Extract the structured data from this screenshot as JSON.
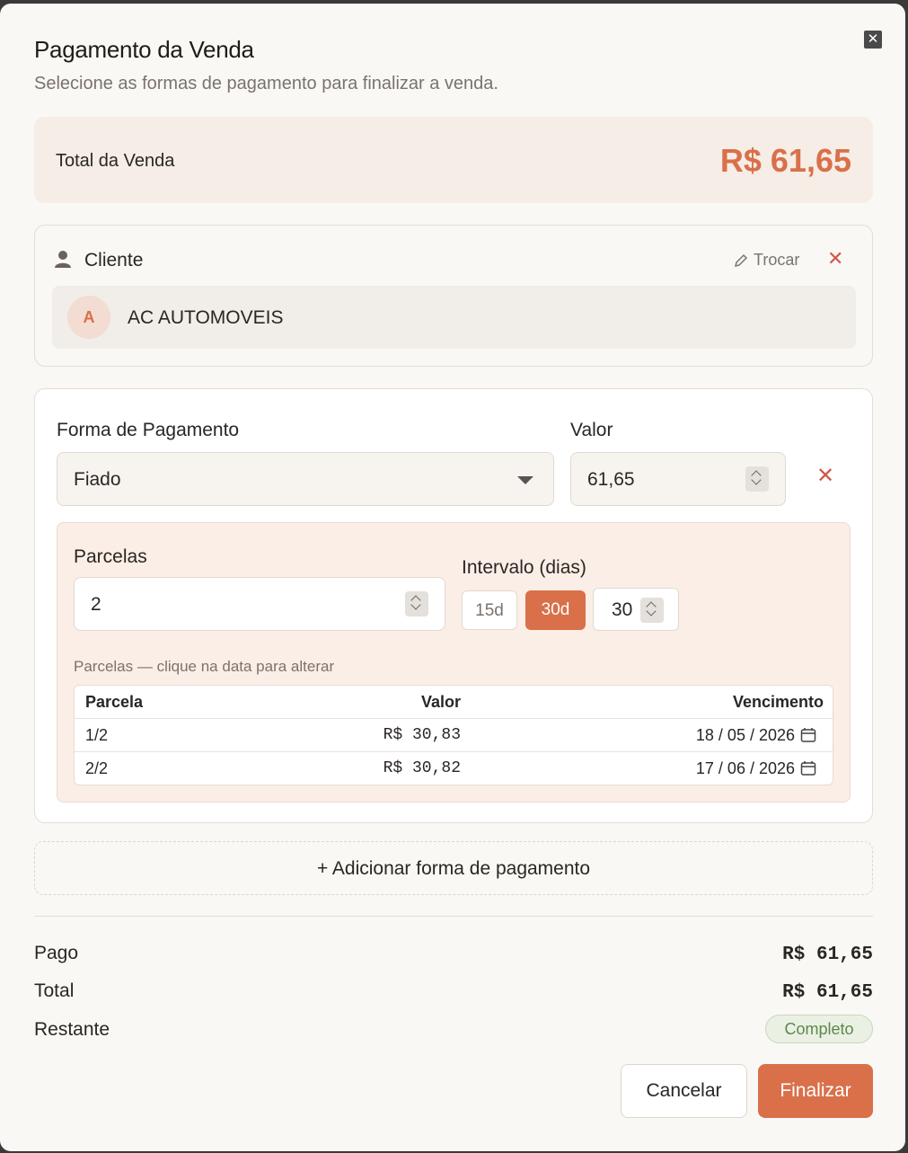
{
  "dialog": {
    "title": "Pagamento da Venda",
    "subtitle": "Selecione as formas de pagamento para finalizar a venda.",
    "close_icon": "close-icon"
  },
  "total": {
    "label": "Total da Venda",
    "value": "R$ 61,65",
    "accent_color": "#d9704a"
  },
  "client": {
    "label": "Cliente",
    "change_label": "Trocar",
    "avatar_letter": "A",
    "name": "AC AUTOMOVEIS"
  },
  "payment": {
    "method_label": "Forma de Pagamento",
    "method_value": "Fiado",
    "amount_label": "Valor",
    "amount_value": "61,65",
    "installments_label": "Parcelas",
    "installments_value": "2",
    "interval_label": "Intervalo (dias)",
    "interval_options": [
      "15d",
      "30d"
    ],
    "interval_selected": "30d",
    "interval_value": "30",
    "hint": "Parcelas — clique na data para alterar",
    "table": {
      "headers": [
        "Parcela",
        "Valor",
        "Vencimento"
      ],
      "rows": [
        {
          "parcela": "1/2",
          "valor": "R$ 30,83",
          "vencimento": "18 / 05 / 2026"
        },
        {
          "parcela": "2/2",
          "valor": "R$ 30,82",
          "vencimento": "17 / 06 / 2026"
        }
      ]
    }
  },
  "add_payment_label": "+ Adicionar forma de pagamento",
  "summary": {
    "paid_label": "Pago",
    "paid_value": "R$ 61,65",
    "total_label": "Total",
    "total_value": "R$ 61,65",
    "remaining_label": "Restante",
    "remaining_status": "Completo"
  },
  "actions": {
    "cancel_label": "Cancelar",
    "finish_label": "Finalizar"
  }
}
